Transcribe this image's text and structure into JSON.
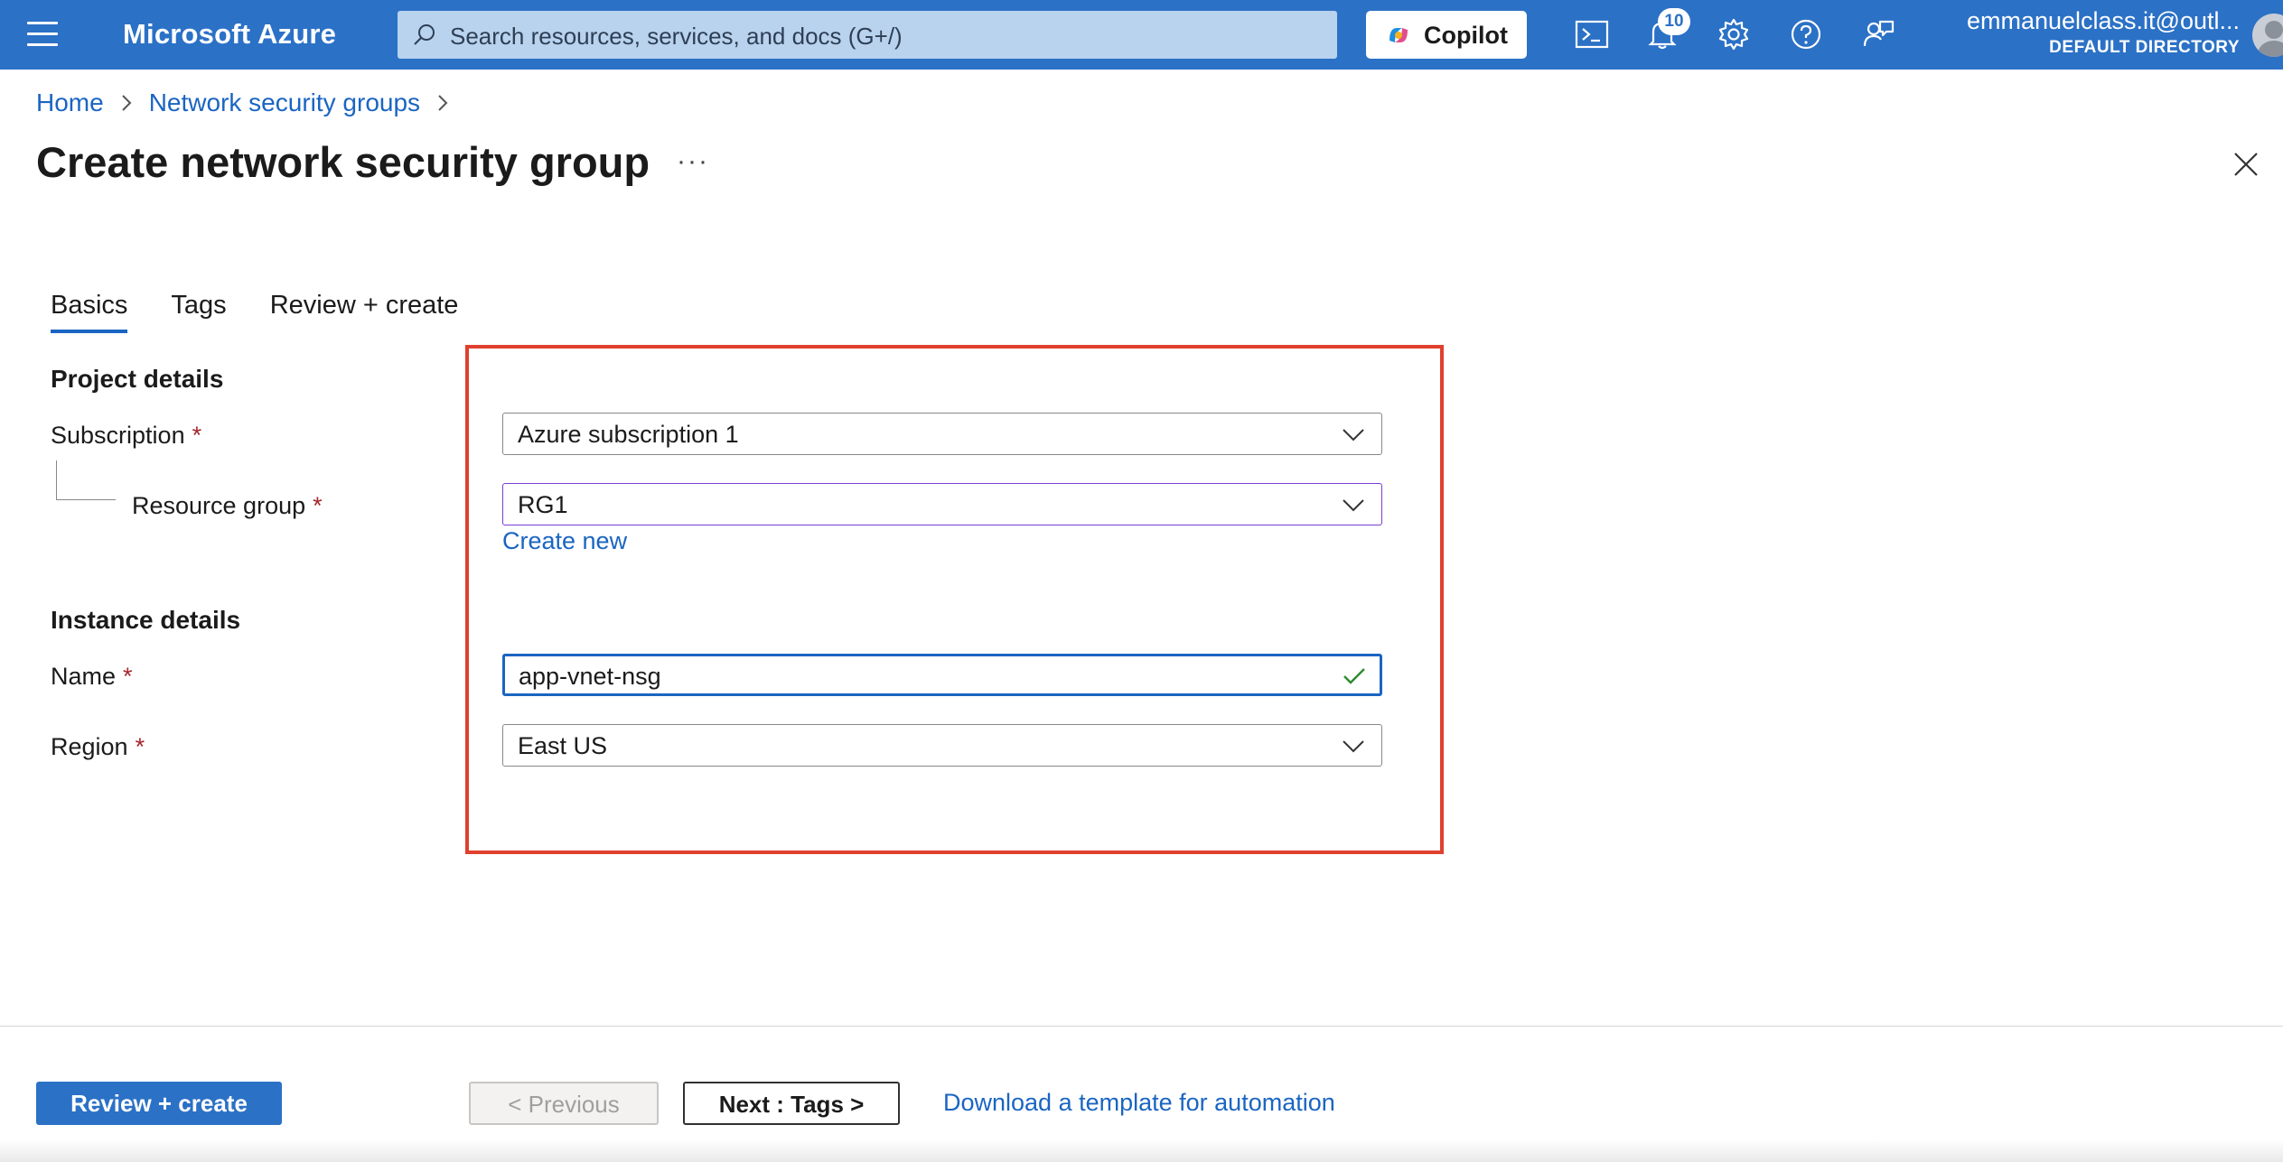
{
  "header": {
    "brand": "Microsoft Azure",
    "search_placeholder": "Search resources, services, and docs (G+/)",
    "copilot_label": "Copilot",
    "notification_count": "10",
    "account_email": "emmanuelclass.it@outl...",
    "account_directory": "DEFAULT DIRECTORY"
  },
  "breadcrumb": {
    "items": [
      "Home",
      "Network security groups"
    ]
  },
  "page": {
    "title": "Create network security group",
    "more_label": "···"
  },
  "tabs": [
    "Basics",
    "Tags",
    "Review + create"
  ],
  "form": {
    "project_details_heading": "Project details",
    "subscription_label": "Subscription",
    "subscription_value": "Azure subscription 1",
    "resource_group_label": "Resource group",
    "resource_group_value": "RG1",
    "create_new_label": "Create new",
    "instance_details_heading": "Instance details",
    "name_label": "Name",
    "name_value": "app-vnet-nsg",
    "region_label": "Region",
    "region_value": "East US",
    "required_marker": "*"
  },
  "footer": {
    "review_create_label": "Review + create",
    "previous_label": "< Previous",
    "next_label": "Next : Tags >",
    "download_label": "Download a template for automation"
  },
  "colors": {
    "azure_blue": "#2b71c6",
    "link_blue": "#1a65c2",
    "highlight_red": "#e0402e",
    "required_red": "#a4262c",
    "valid_green": "#2e8b2e"
  }
}
